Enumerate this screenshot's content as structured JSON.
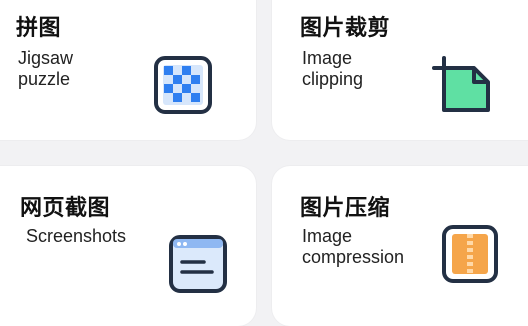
{
  "tools": [
    {
      "title": "拼图",
      "subtitle": "Jigsaw\npuzzle",
      "icon": "jigsaw-puzzle-icon"
    },
    {
      "title": "图片裁剪",
      "subtitle": "Image\nclipping",
      "icon": "crop-icon"
    },
    {
      "title": "网页截图",
      "subtitle": "Screenshots",
      "icon": "webpage-screenshot-icon"
    },
    {
      "title": "图片压缩",
      "subtitle": "Image\ncompression",
      "icon": "zip-compress-icon"
    }
  ],
  "colors": {
    "page_bg": "#f2f2f4",
    "card_bg": "#ffffff",
    "icon_outline": "#233044",
    "puzzle_blue": "#2f7ff0",
    "crop_green": "#5fe0a3",
    "screenshot_blue": "#dbe9fb",
    "zip_orange": "#f5a54a"
  }
}
